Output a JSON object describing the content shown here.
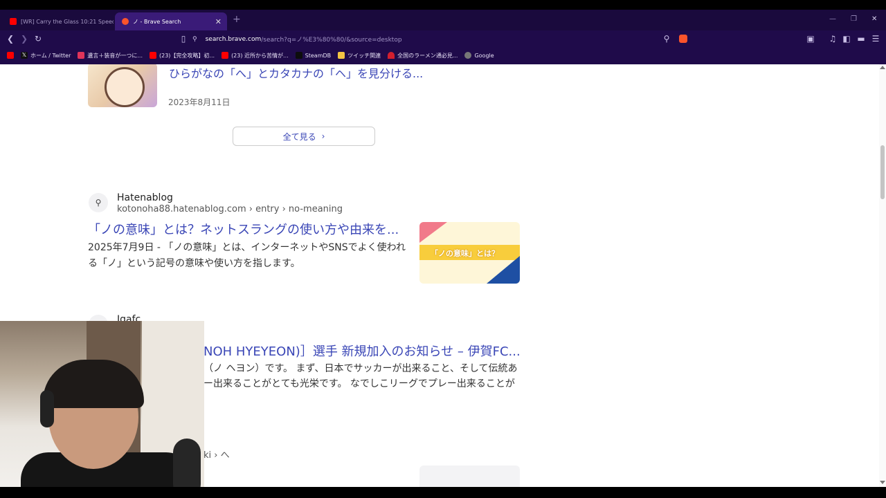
{
  "browser": {
    "tabs": [
      {
        "title": "[WR] Carry the Glass 10:21 Speedrun",
        "active": false
      },
      {
        "title": "ノ - Brave Search",
        "active": true
      }
    ],
    "url_host": "search.brave.com",
    "url_rest": "/search?q=ノ%E3%80%80/&source=desktop",
    "bookmarks": [
      {
        "label": "",
        "icon": "youtube-icon"
      },
      {
        "label": "ホーム / Twitter",
        "icon": "x-icon"
      },
      {
        "label": "遺言＋装音が一つに...",
        "icon": "app-icon"
      },
      {
        "label": "(23)【完全攻略】初...",
        "icon": "youtube-icon"
      },
      {
        "label": "(23) 近所から苦情が...",
        "icon": "youtube-icon"
      },
      {
        "label": "SteamDB",
        "icon": "steamdb-icon"
      },
      {
        "label": "ツイッチ関連",
        "icon": "folder-icon"
      },
      {
        "label": "全国のラーメン通必見...",
        "icon": "ramen-icon"
      },
      {
        "label": "Google",
        "icon": "globe-icon"
      }
    ]
  },
  "results": {
    "top_item": {
      "title": "ひらがなの「へ」とカタカナの「ヘ」を見分ける...",
      "date": "2023年8月11日"
    },
    "see_all_label": "全て見る",
    "r1": {
      "site": "Hatenablog",
      "url": "kotonoha88.hatenablog.com › entry › no-meaning",
      "title": "「ノの意味」とは？ネットスラングの使い方や由来を...",
      "desc": "2025年7月9日 - 「ノの意味」とは、インターネットやSNSでよく使われる「ノ」という記号の意味や使い方を指します。",
      "thumb_text": "「ノの意味」とは？"
    },
    "r2": {
      "site": "Igafc",
      "title": "NOH HYEYEON)］選手 新規加入のお知らせ – 伊賀FC...",
      "desc1": "（ノ ヘヨン）です。 まず、日本でサッカーが出来ること、そして伝統あ",
      "desc2": "ー出来ることがとても光栄です。 なでしこリーグでプレー出来ることが"
    },
    "r3": {
      "url": "ki › へ"
    }
  }
}
